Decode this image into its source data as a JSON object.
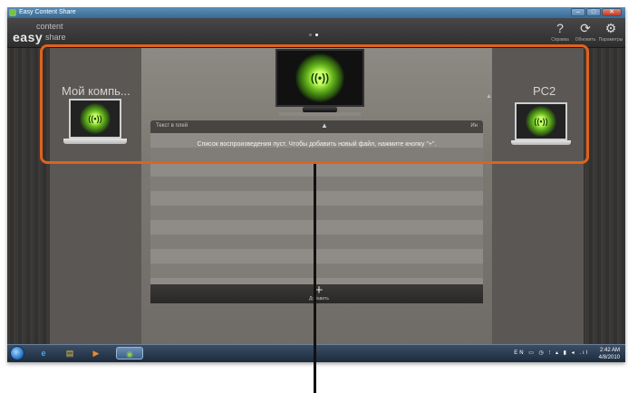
{
  "window": {
    "title": "Easy Content Share",
    "controls": [
      "–",
      "□",
      "✕"
    ]
  },
  "logo": {
    "top": "content",
    "main": "easy",
    "sub": "share"
  },
  "toolbar": {
    "help": {
      "icon": "question-icon",
      "glyph": "?",
      "label": "Справка"
    },
    "refresh": {
      "icon": "refresh-icon",
      "glyph": "⟳",
      "label": "Обновить"
    },
    "settings": {
      "icon": "gear-icon",
      "glyph": "⚙",
      "label": "Параметры"
    }
  },
  "devices": {
    "left": {
      "label": "Мой компь..."
    },
    "center": {
      "label": "TV"
    },
    "right": {
      "label": "PC2"
    },
    "signal_glyph": "((•))"
  },
  "playlist": {
    "header_left": "Текст в плей",
    "header_right": "Ин",
    "header_mid": "▲",
    "empty_message": "Список воспроизведения пуст. Чтобы добавить новый файл, нажмите кнопку \"+\".",
    "add_glyph": "+",
    "add_label": "Добавить"
  },
  "taskbar": {
    "icons": [
      "start-orb",
      "internet-explorer-icon",
      "explorer-icon",
      "media-player-icon",
      "easy-content-share-icon"
    ],
    "glyphs": [
      "",
      "e",
      "▤",
      "▶",
      "◉"
    ],
    "tray": "EN ▭ ◷ ⁝ ▴ ▮ ◂ .ıl",
    "time": "2:42 AM",
    "date": "4/8/2010"
  },
  "colors": {
    "highlight": "#e0621b",
    "signal": "#7ecb2a"
  }
}
